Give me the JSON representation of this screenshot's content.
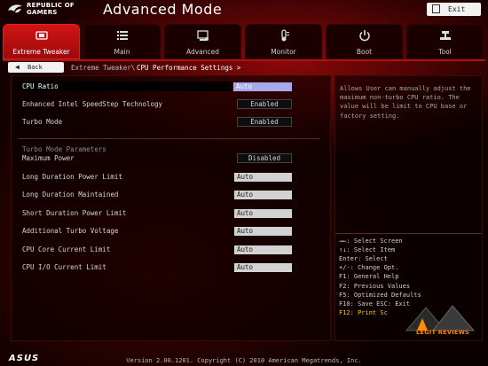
{
  "header": {
    "brand_line1": "REPUBLIC OF",
    "brand_line2": "GAMERS",
    "title": "Advanced Mode",
    "exit_label": "Exit"
  },
  "tabs": [
    {
      "label": "Extreme Tweaker",
      "icon": "tweaker-icon",
      "active": true
    },
    {
      "label": "Main",
      "icon": "list-icon",
      "active": false
    },
    {
      "label": "Advanced",
      "icon": "advanced-icon",
      "active": false
    },
    {
      "label": "Monitor",
      "icon": "monitor-icon",
      "active": false
    },
    {
      "label": "Boot",
      "icon": "power-icon",
      "active": false
    },
    {
      "label": "Tool",
      "icon": "tool-icon",
      "active": false
    }
  ],
  "breadcrumb": {
    "back_label": "Back",
    "parent": "Extreme Tweaker\\",
    "current": "CPU Performance Settings >"
  },
  "settings": {
    "cpu_ratio": {
      "label": "CPU Ratio",
      "value": "Auto"
    },
    "speedstep": {
      "label": "Enhanced Intel SpeedStep Technology",
      "value": "Enabled"
    },
    "turbo_mode": {
      "label": "Turbo Mode",
      "value": "Enabled"
    },
    "turbo_params_heading": "Turbo Mode Parameters",
    "max_power": {
      "label": "Maximum Power",
      "value": "Disabled"
    },
    "long_power_limit": {
      "label": "Long Duration Power Limit",
      "value": "Auto"
    },
    "long_maintained": {
      "label": "Long Duration Maintained",
      "value": "Auto"
    },
    "short_power_limit": {
      "label": "Short Duration Power Limit",
      "value": "Auto"
    },
    "additional_turbo_voltage": {
      "label": "Additional Turbo Voltage",
      "value": "Auto"
    },
    "core_current_limit": {
      "label": "CPU Core Current Limit",
      "value": "Auto"
    },
    "io_current_limit": {
      "label": "CPU I/O Current Limit",
      "value": "Auto"
    }
  },
  "help": {
    "lines": [
      "Allows User can manually adjust the",
      "maximum non-turbo CPU ratio. The",
      "value will be limit to CPU base or",
      "factory setting."
    ],
    "keys": [
      "→←: Select Screen",
      "↑↓: Select Item",
      "Enter: Select",
      "+/-: Change Opt.",
      "F1: General Help",
      "F2: Previous Values",
      "F5: Optimized Defaults",
      "F10: Save  ESC: Exit",
      "F12: Print Sc"
    ]
  },
  "watermark": "LEGIT REVIEWS",
  "footer": {
    "brand": "ASUS",
    "version": "Version 2.00.1201. Copyright (C) 2010 American Megatrends, Inc."
  },
  "colors": {
    "accent": "#c8101a",
    "selected_value": "#a6a9ea",
    "key_highlight": "#f0d000",
    "watermark": "#ff8c00"
  }
}
